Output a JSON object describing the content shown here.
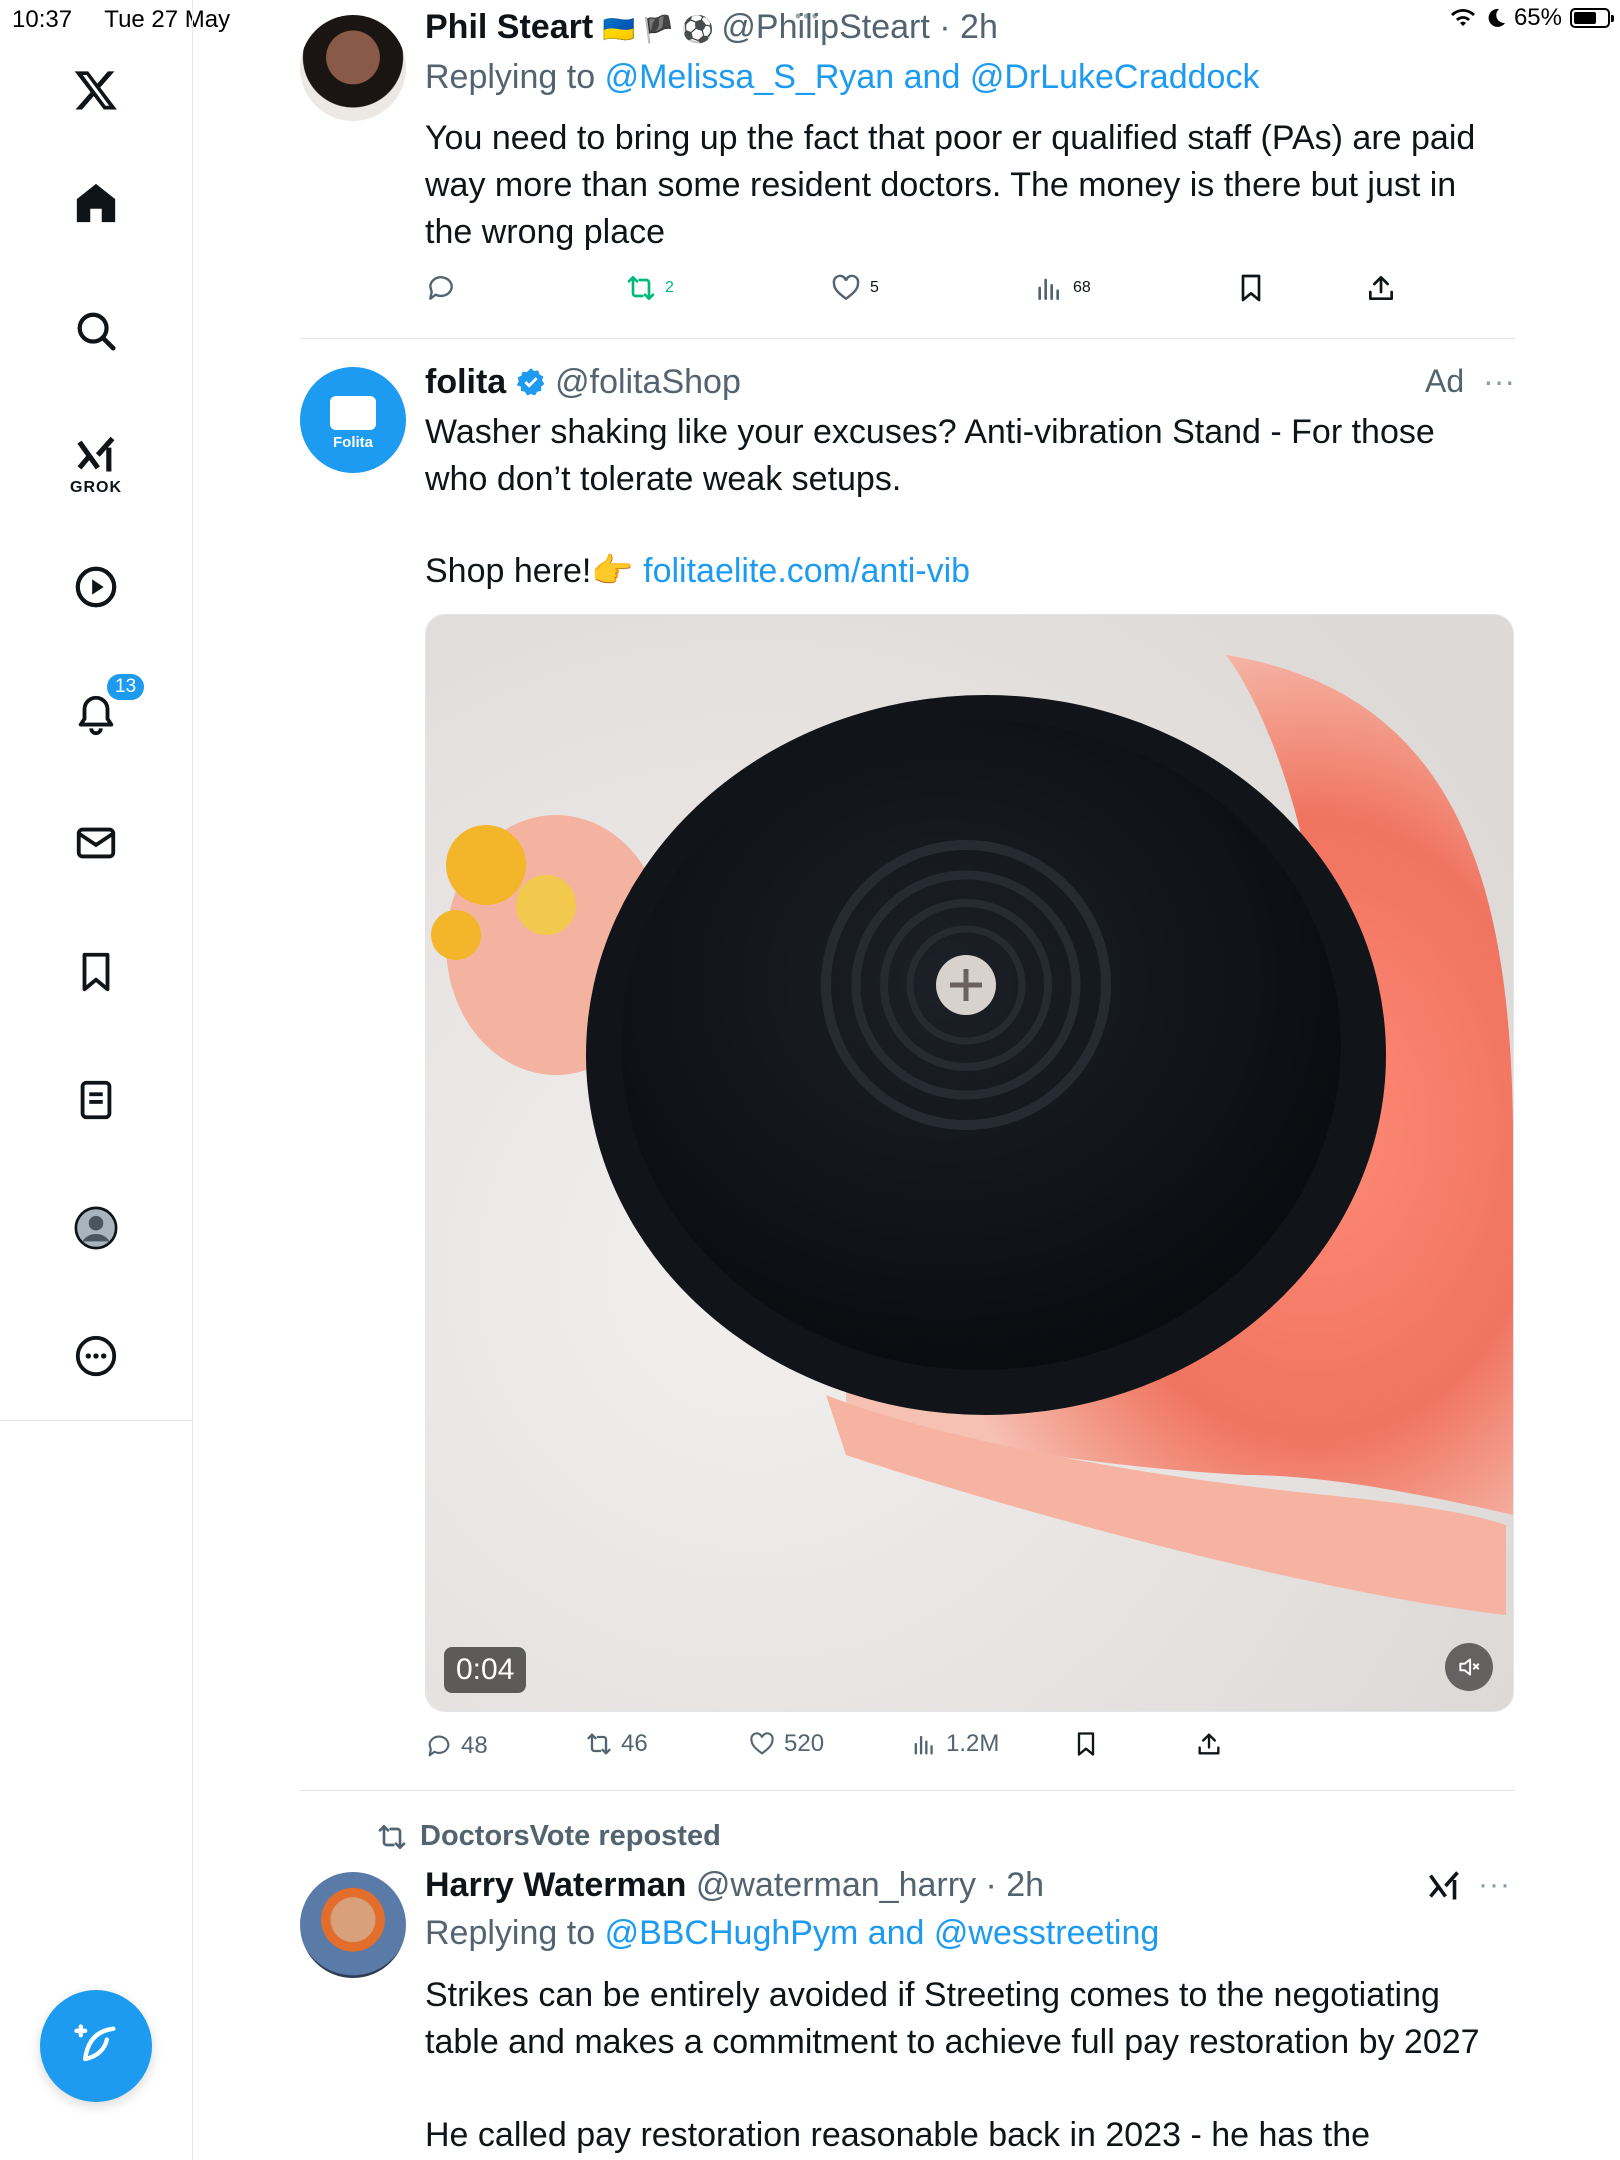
{
  "status_bar": {
    "time": "10:37",
    "date": "Tue 27 May",
    "battery_text": "65%",
    "battery_level": 0.65
  },
  "sidebar": {
    "items": [
      {
        "name": "x-logo"
      },
      {
        "name": "home"
      },
      {
        "name": "search"
      },
      {
        "name": "grok",
        "label": "GROK"
      },
      {
        "name": "video"
      },
      {
        "name": "notifications",
        "badge": "13"
      },
      {
        "name": "messages"
      },
      {
        "name": "bookmarks"
      },
      {
        "name": "lists"
      },
      {
        "name": "profile"
      },
      {
        "name": "more"
      }
    ]
  },
  "tweets": [
    {
      "name": "Phil Steart",
      "handle": "@PhilipSteart",
      "time": "2h",
      "replying_prefix": "Replying to",
      "replying_to": "@Melissa_S_Ryan and @DrLukeCraddock",
      "text": "You need to bring up the fact that poor er qualified staff  (PAs) are paid way more than some resident doctors. The money is there but just in the wrong place",
      "retweets": "2",
      "likes": "5",
      "views": "68"
    },
    {
      "name": "folita",
      "handle": "@folitaShop",
      "ad_label": "Ad",
      "avatar_text": "Folita",
      "text": "Washer shaking like your excuses? Anti-vibration Stand - For those who don’t tolerate weak setups.",
      "shop_text": "Shop here!👉",
      "shop_link": "folitaelite.com/anti-vib",
      "video_time": "0:04",
      "replies": "48",
      "retweets": "46",
      "likes": "520",
      "views": "1.2M"
    },
    {
      "repost_by": "DoctorsVote reposted",
      "name": "Harry Waterman",
      "handle": "@waterman_harry",
      "time": "2h",
      "replying_prefix": "Replying to",
      "replying_to": "@BBCHughPym and @wesstreeting",
      "text": "Strikes can be entirely avoided if Streeting comes to the negotiating table and makes a commitment to achieve full pay restoration by 2027",
      "text2": "He called pay restoration reasonable back in 2023 - he has the"
    }
  ],
  "colors": {
    "accent": "#1d9bf0",
    "retweet_green": "#00ba7c",
    "muted": "#536471"
  }
}
